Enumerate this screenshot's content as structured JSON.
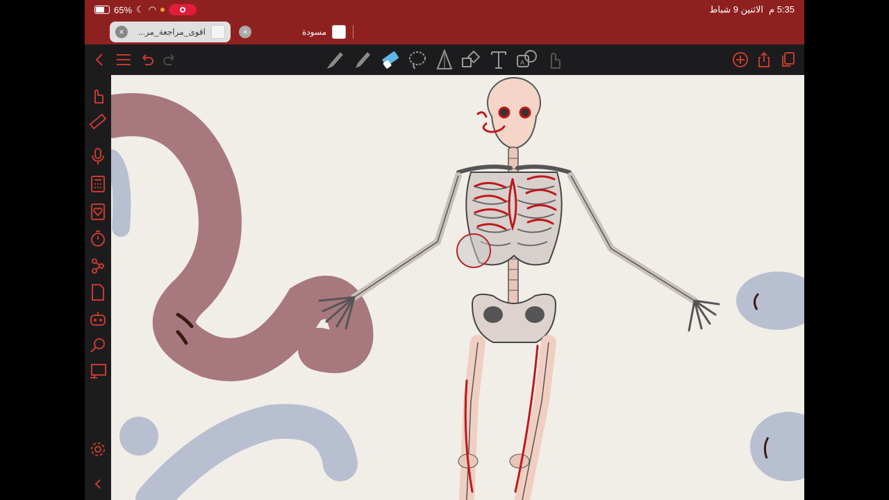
{
  "status": {
    "battery_pct": "65%",
    "time": "5:35 م",
    "date": "الاثنين 9 شباط"
  },
  "tabs": [
    {
      "label": "اقوى_مراجعة_مر...",
      "active": true
    },
    {
      "label": "مسودة",
      "active": false
    }
  ],
  "colors": {
    "accent": "#c93a2e",
    "topbar": "#8e2120",
    "canvas": "#f1eee8",
    "ink": "#c0171a"
  },
  "toolbar": {
    "left_icons": [
      "back-icon",
      "menu-icon",
      "undo-icon",
      "redo-icon"
    ],
    "tools": [
      "pen-icon",
      "highlighter-icon",
      "eraser-icon",
      "lasso-icon",
      "ruler-shape-icon",
      "shapes-icon",
      "text-icon",
      "translate-icon",
      "finger-icon"
    ],
    "right_icons": [
      "add-page-icon",
      "share-icon",
      "pages-icon"
    ]
  },
  "sidebar": {
    "icons": [
      "hand-icon",
      "ruler-icon",
      "microphone-icon",
      "calculator-icon",
      "favorite-icon",
      "timer-icon",
      "mindmap-icon",
      "document-icon",
      "assistant-icon",
      "search-icon",
      "presentation-icon",
      "settings-icon",
      "collapse-icon"
    ]
  }
}
